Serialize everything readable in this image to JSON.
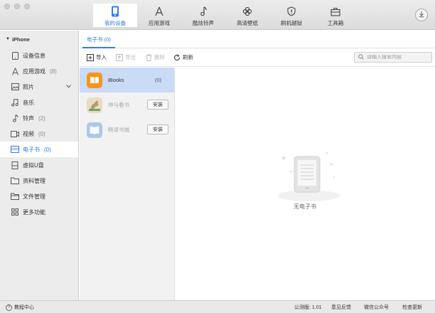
{
  "toolbar": {
    "nav": [
      {
        "label": "我的设备",
        "icon": "phone-icon",
        "active": true
      },
      {
        "label": "应用游戏",
        "icon": "app-store-icon"
      },
      {
        "label": "酷炫铃声",
        "icon": "music-note-icon"
      },
      {
        "label": "高清壁纸",
        "icon": "flower-icon"
      },
      {
        "label": "刷机越狱",
        "icon": "shield-icon"
      },
      {
        "label": "工具箱",
        "icon": "toolbox-icon"
      }
    ]
  },
  "sidebar": {
    "device": "iPhone",
    "items": [
      {
        "label": "设备信息",
        "count": ""
      },
      {
        "label": "应用游戏",
        "count": "(8)"
      },
      {
        "label": "照片",
        "count": ""
      },
      {
        "label": "音乐",
        "count": ""
      },
      {
        "label": "铃声",
        "count": "(2)"
      },
      {
        "label": "视频",
        "count": "(0)"
      },
      {
        "label": "电子书",
        "count": "(0)"
      },
      {
        "label": "虚拟U盘",
        "count": ""
      },
      {
        "label": "资料管理",
        "count": ""
      },
      {
        "label": "文件管理",
        "count": ""
      },
      {
        "label": "更多功能",
        "count": ""
      }
    ]
  },
  "main": {
    "tab": "电子书 (0)",
    "actions": {
      "import": "导入",
      "export": "导出",
      "delete": "删除",
      "refresh": "刷新"
    },
    "search_placeholder": "请输入搜索内容",
    "apps": [
      {
        "name": "iBooks",
        "count": "(0)"
      },
      {
        "name": "神马看书",
        "button": "安装"
      },
      {
        "name": "畅读书城",
        "button": "安装"
      }
    ],
    "empty_text": "无电子书"
  },
  "statusbar": {
    "help": "教程中心",
    "version": "公测版: 1.01",
    "feedback": "意见反馈",
    "wechat": "微信公众号",
    "update": "检查更新"
  },
  "colors": {
    "accent": "#2e7cf6",
    "selected_row": "#c9dbf6",
    "ibooks": "#f7941d"
  }
}
